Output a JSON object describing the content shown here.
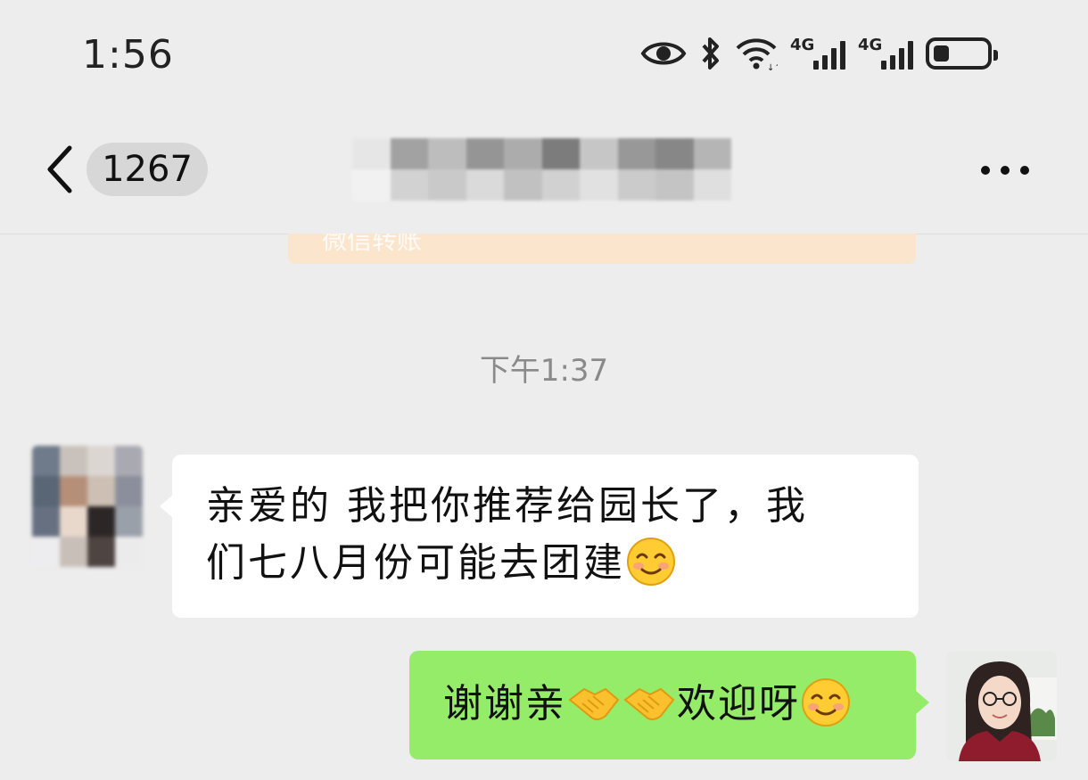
{
  "status_bar": {
    "time": "1:56",
    "icons": [
      "eye-icon",
      "bluetooth-icon",
      "wifi-icon",
      "signal-4g-icon",
      "signal-4g-icon",
      "battery-icon"
    ],
    "network_1": "4G",
    "network_2": "4G",
    "battery_level": 0.3
  },
  "header": {
    "back_icon": "chevron-left-icon",
    "unread_count": "1267",
    "more_icon": "more-horizontal-icon"
  },
  "messages": {
    "previous_card_label": "微信转账",
    "time_divider": "下午1:37",
    "incoming": {
      "line1": "亲爱的  我把你推荐给园长了，我",
      "line2": "们七八月份可能去团建"
    },
    "outgoing": {
      "text1": "谢谢亲",
      "text2": "欢迎呀"
    },
    "emojis": [
      "smile-emoji",
      "handshake-emoji"
    ]
  },
  "colors": {
    "background": "#ededed",
    "incoming_bubble": "#ffffff",
    "outgoing_bubble": "#95ec69",
    "transfer_card": "#fbe5cc"
  }
}
